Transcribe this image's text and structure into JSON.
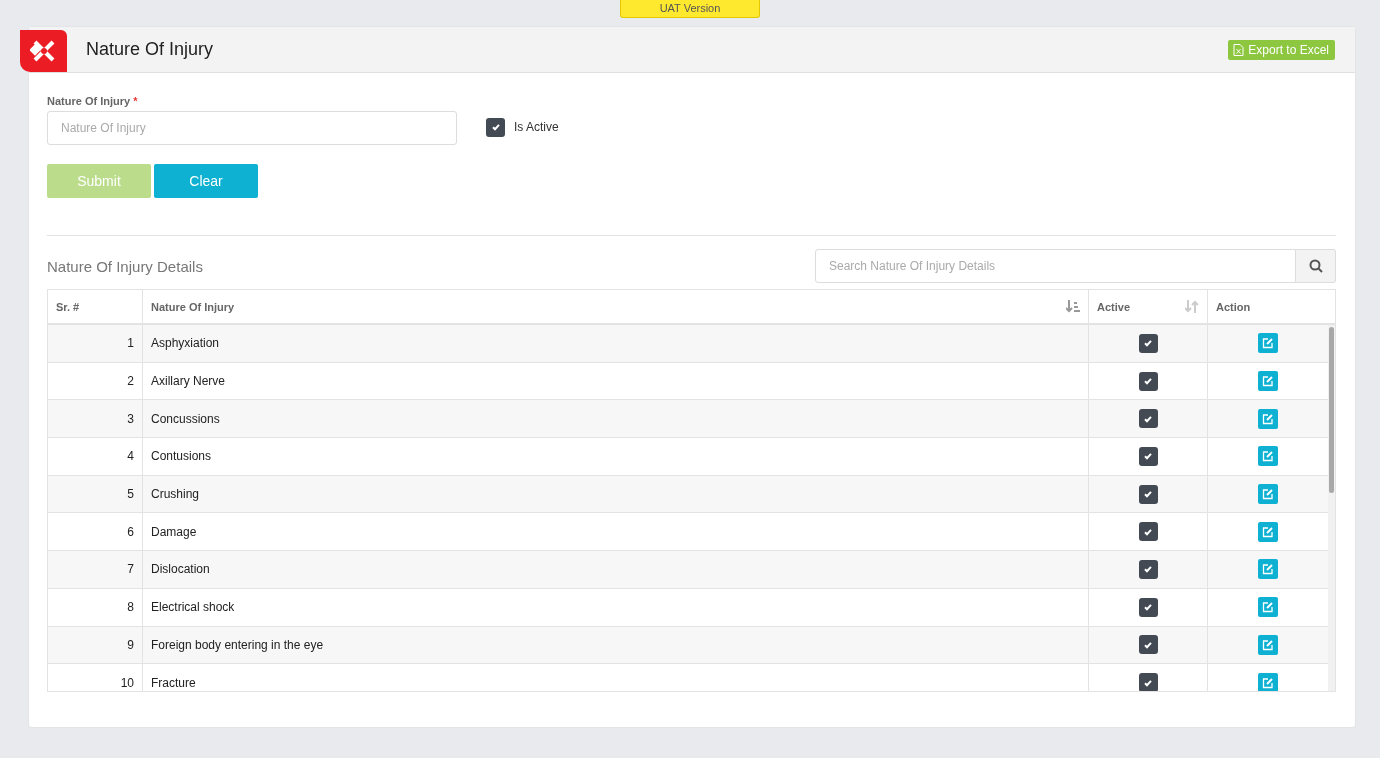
{
  "environment_badge": "UAT Version",
  "header": {
    "title": "Nature Of Injury",
    "export_button": "Export to Excel"
  },
  "form": {
    "field": {
      "label": "Nature Of Injury",
      "required_mark": "*",
      "placeholder": "Nature Of Injury"
    },
    "is_active": {
      "label": "Is Active",
      "checked": true
    },
    "buttons": [
      {
        "label": "Submit",
        "kind": "submit",
        "disabled": true
      },
      {
        "label": "Clear",
        "kind": "clear",
        "disabled": false
      }
    ]
  },
  "details": {
    "title": "Nature Of Injury Details",
    "search": {
      "placeholder": "Search Nature Of Injury Details"
    },
    "table": {
      "columns": [
        {
          "label": "Sr. #",
          "sortable": false
        },
        {
          "label": "Nature Of Injury",
          "sortable": true,
          "sorted_ascending": true
        },
        {
          "label": "Active",
          "sortable": true,
          "sorted_ascending": false
        },
        {
          "label": "Action",
          "sortable": false
        }
      ],
      "rows": [
        {
          "sr": "1",
          "name": "Asphyxiation",
          "active": true
        },
        {
          "sr": "2",
          "name": "Axillary Nerve",
          "active": true
        },
        {
          "sr": "3",
          "name": "Concussions",
          "active": true
        },
        {
          "sr": "4",
          "name": "Contusions",
          "active": true
        },
        {
          "sr": "5",
          "name": "Crushing",
          "active": true
        },
        {
          "sr": "6",
          "name": "Damage",
          "active": true
        },
        {
          "sr": "7",
          "name": "Dislocation",
          "active": true
        },
        {
          "sr": "8",
          "name": "Electrical shock",
          "active": true
        },
        {
          "sr": "9",
          "name": "Foreign body entering in the eye",
          "active": true
        },
        {
          "sr": "10",
          "name": "Fracture",
          "active": true
        }
      ]
    }
  }
}
